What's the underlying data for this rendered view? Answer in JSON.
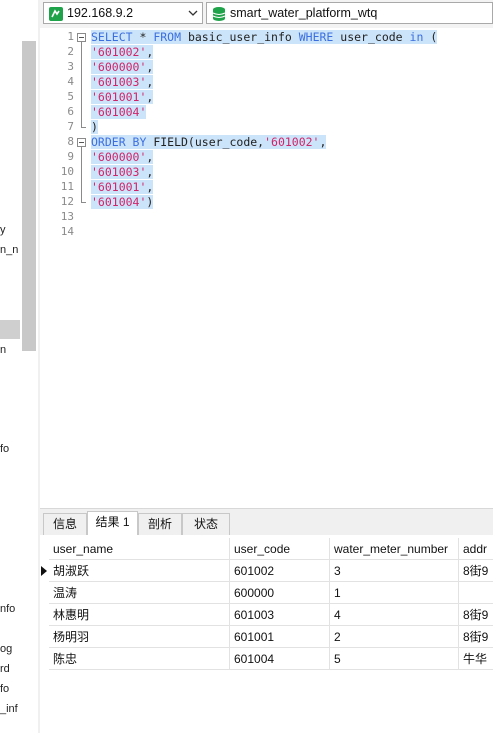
{
  "toolbar": {
    "connection": "192.168.9.2",
    "database": "smart_water_platform_wtq"
  },
  "left_panel": {
    "items": [
      "y",
      "n_n",
      "n",
      "fo",
      "nfo",
      "og",
      "rd",
      "fo",
      "_inf"
    ]
  },
  "editor": {
    "line_numbers": [
      "1",
      "2",
      "3",
      "4",
      "5",
      "6",
      "7",
      "8",
      "9",
      "10",
      "11",
      "12",
      "13",
      "14"
    ],
    "lines": [
      [
        {
          "t": "kw",
          "v": "SELECT"
        },
        {
          "t": "pl",
          "v": " * "
        },
        {
          "t": "kw",
          "v": "FROM"
        },
        {
          "t": "pl",
          "v": " basic_user_info "
        },
        {
          "t": "kw",
          "v": "WHERE"
        },
        {
          "t": "pl",
          "v": " user_code "
        },
        {
          "t": "kw",
          "v": "in"
        },
        {
          "t": "pl",
          "v": " ("
        }
      ],
      [
        {
          "t": "str",
          "v": "'601002'"
        },
        {
          "t": "pl",
          "v": ","
        }
      ],
      [
        {
          "t": "str",
          "v": "'600000'"
        },
        {
          "t": "pl",
          "v": ","
        }
      ],
      [
        {
          "t": "str",
          "v": "'601003'"
        },
        {
          "t": "pl",
          "v": ","
        }
      ],
      [
        {
          "t": "str",
          "v": "'601001'"
        },
        {
          "t": "pl",
          "v": ","
        }
      ],
      [
        {
          "t": "str",
          "v": "'601004'"
        }
      ],
      [
        {
          "t": "pl",
          "v": ")"
        }
      ],
      [
        {
          "t": "kw",
          "v": "ORDER BY"
        },
        {
          "t": "pl",
          "v": " FIELD(user_code,"
        },
        {
          "t": "str",
          "v": "'601002'"
        },
        {
          "t": "pl",
          "v": ","
        }
      ],
      [
        {
          "t": "str",
          "v": "'600000'"
        },
        {
          "t": "pl",
          "v": ","
        }
      ],
      [
        {
          "t": "str",
          "v": "'601003'"
        },
        {
          "t": "pl",
          "v": ","
        }
      ],
      [
        {
          "t": "str",
          "v": "'601001'"
        },
        {
          "t": "pl",
          "v": ","
        }
      ],
      [
        {
          "t": "str",
          "v": "'601004'"
        },
        {
          "t": "pl",
          "v": ")"
        }
      ],
      [],
      []
    ]
  },
  "result_tabs": [
    "信息",
    "结果 1",
    "剖析",
    "状态"
  ],
  "active_tab": "结果 1",
  "result": {
    "columns": [
      "user_name",
      "user_code",
      "water_meter_number",
      "addr"
    ],
    "rows": [
      [
        "胡淑跃",
        "601002",
        "3",
        "8街9"
      ],
      [
        "温涛",
        "600000",
        "1",
        ""
      ],
      [
        "林惠明",
        "601003",
        "4",
        "8街9"
      ],
      [
        "杨明羽",
        "601001",
        "2",
        "8街9"
      ],
      [
        "陈忠",
        "601004",
        "5",
        "牛华"
      ]
    ]
  },
  "colors": {
    "keyword": "#3b6fe0",
    "string": "#d0246a",
    "selection": "#cce4f9",
    "connection_icon": "#1fa34a",
    "database_icon": "#1fa34a"
  },
  "icons": {
    "connection": "mysql-connection-icon",
    "database": "database-icon",
    "dropdown": "chevron-down-icon",
    "current_row": "current-row-arrow-icon"
  }
}
